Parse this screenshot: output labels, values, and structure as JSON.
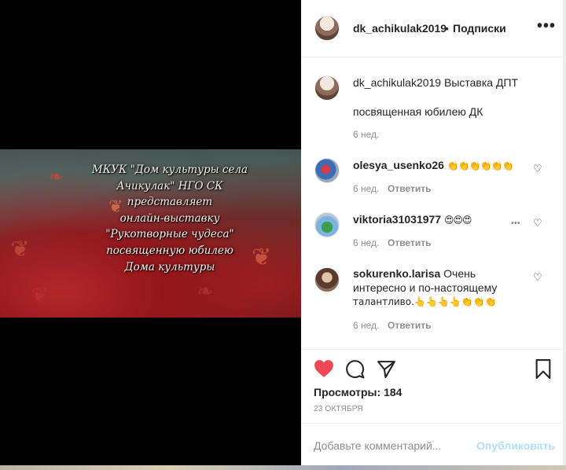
{
  "post": {
    "author": "dk_achikulak2019",
    "follow_label": "Подписки",
    "separator": "•",
    "more_label": "•••"
  },
  "video": {
    "overlay_lines": [
      "МКУК \"Дом культуры села",
      "Ачикулак\" НГО СК",
      "представляет",
      "онлайн-выставку",
      "\"Рукотворные чудеса\"",
      "посвященную юбилею",
      "Дома культуры"
    ]
  },
  "caption": {
    "username": "dk_achikulak2019",
    "text_line1": "Выставка ДПТ",
    "text_line2": "посвященная юбилею ДК",
    "time": "6 нед."
  },
  "comments": [
    {
      "username": "olesya_usenko26",
      "text": "👏👏👏👏👏👏",
      "time": "6 нед.",
      "reply": "Ответить",
      "avatar": "photo"
    },
    {
      "username": "viktoria31031977",
      "text": "😍😍😍",
      "time": "6 нед.",
      "reply": "Ответить",
      "more": "•••",
      "avatar": "photo"
    },
    {
      "username": "sokurenko.larisa",
      "text_line1": "Очень",
      "text_line2": "интересно и по-настоящему",
      "text_line3": "талантливо.👆👆👆👆👏👏👏",
      "time": "6 нед.",
      "reply": "Ответить",
      "avatar": "photo"
    }
  ],
  "actions": {
    "like_icon": "heart-filled",
    "comment_icon": "speech-bubble",
    "share_icon": "paper-plane",
    "save_icon": "bookmark",
    "like_color": "#ed4956"
  },
  "stats": {
    "views_label": "Просмотры:",
    "views_count": "184",
    "date": "23 ОКТЯБРЯ"
  },
  "add_comment": {
    "placeholder": "Добавьте комментарий...",
    "publish_label": "Опубликовать",
    "publish_color": "#b2dffc"
  }
}
